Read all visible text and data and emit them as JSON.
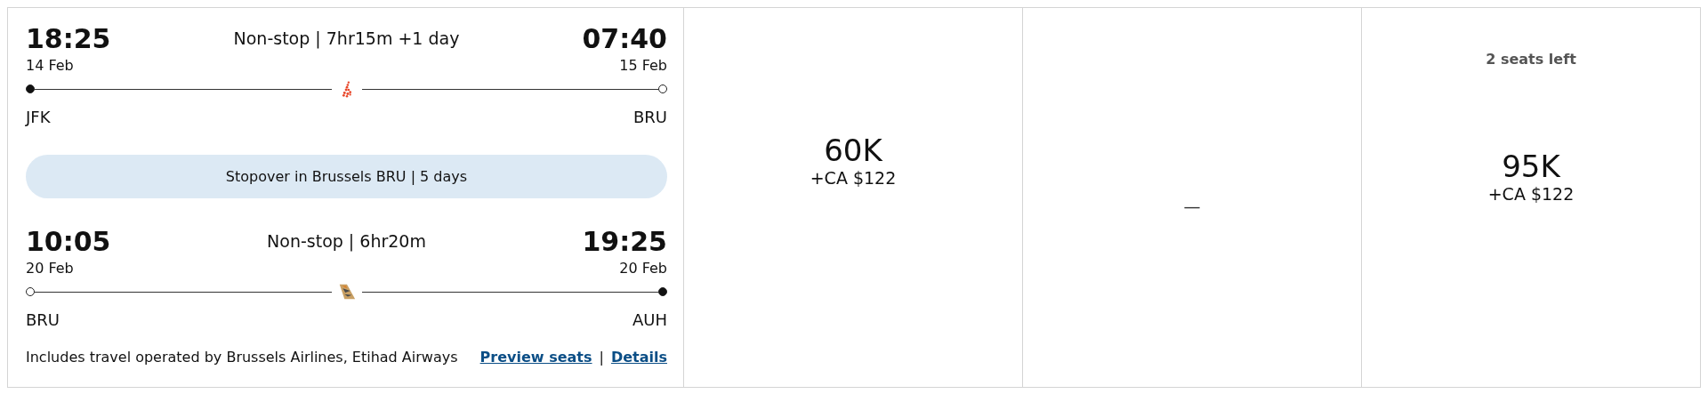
{
  "segments": [
    {
      "depart_time": "18:25",
      "depart_date": "14 Feb",
      "duration": "Non-stop | 7hr15m +1 day",
      "arrive_time": "07:40",
      "arrive_date": "15 Feb",
      "origin": "JFK",
      "destination": "BRU",
      "origin_filled": true,
      "destination_filled": false,
      "kind": "dots"
    },
    {
      "depart_time": "10:05",
      "depart_date": "20 Feb",
      "duration": "Non-stop | 6hr20m",
      "arrive_time": "19:25",
      "arrive_date": "20 Feb",
      "origin": "BRU",
      "destination": "AUH",
      "origin_filled": false,
      "destination_filled": true,
      "kind": "tail"
    }
  ],
  "stopover": "Stopover in Brussels BRU | 5 days",
  "operated_by": "Includes travel operated by Brussels Airlines, Etihad Airways",
  "links": [
    "Preview seats",
    "Details"
  ],
  "link_separator": "|",
  "fares": [
    {
      "kind": "price",
      "points": "60K",
      "cash": "+CA $122"
    },
    {
      "kind": "none",
      "text": "—"
    },
    {
      "kind": "price",
      "note": "2 seats left",
      "points": "95K",
      "cash": "+CA $122"
    }
  ]
}
